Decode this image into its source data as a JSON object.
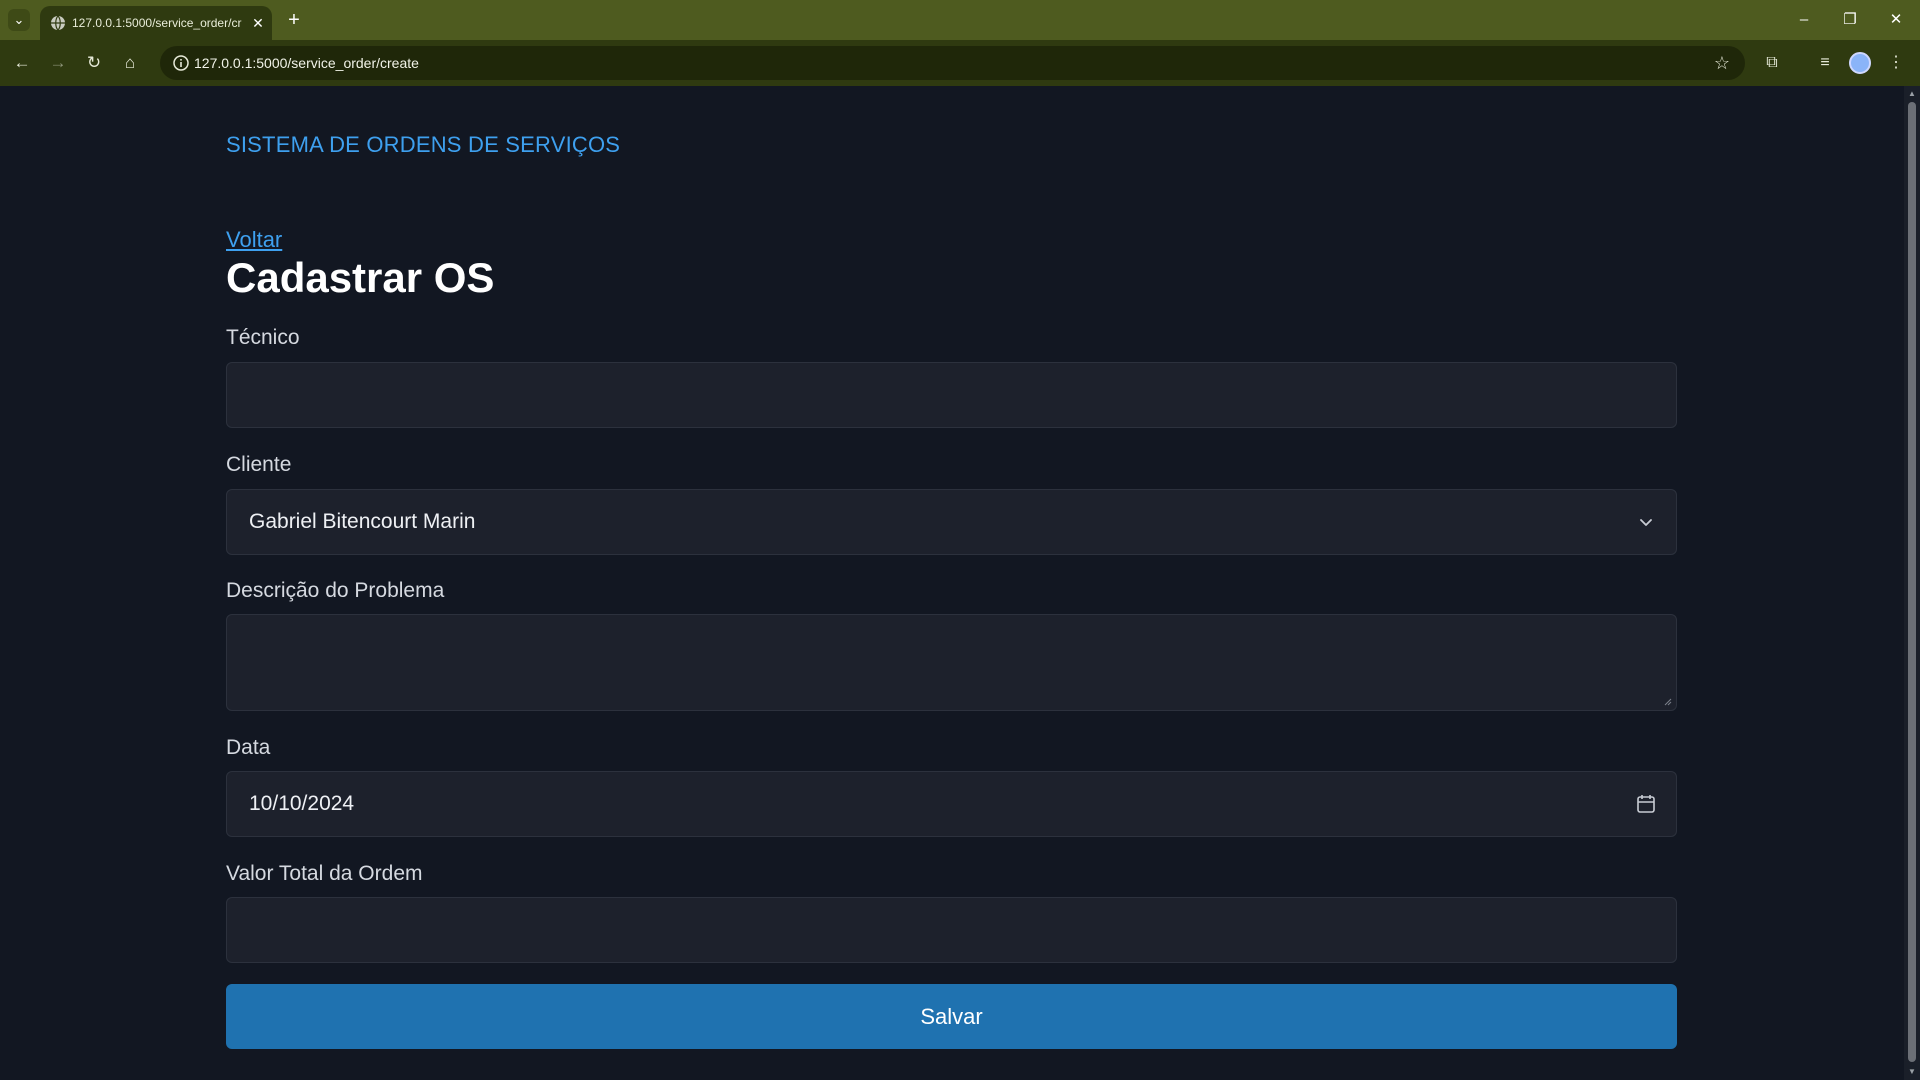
{
  "browser": {
    "tab_title": "127.0.0.1:5000/service_order/cr",
    "url": "127.0.0.1:5000/service_order/create",
    "window_controls": {
      "minimize": "–",
      "restore": "❐",
      "close": "✕"
    }
  },
  "page": {
    "brand": "SISTEMA DE ORDENS DE SERVIÇOS",
    "back_link": "Voltar",
    "title": "Cadastrar OS",
    "form": {
      "tecnico": {
        "label": "Técnico",
        "value": ""
      },
      "cliente": {
        "label": "Cliente",
        "value": "Gabriel Bitencourt Marin"
      },
      "descricao": {
        "label": "Descrição do Problema",
        "value": ""
      },
      "data": {
        "label": "Data",
        "value": "10/10/2024"
      },
      "valor_total": {
        "label": "Valor Total da Ordem",
        "value": ""
      }
    },
    "submit_label": "Salvar"
  },
  "colors": {
    "tabbar": "#4e5b1f",
    "toolbar": "#2f3a10",
    "page_bg": "#121722",
    "field_bg": "#1d212c",
    "link": "#3ea0ef",
    "button": "#1f72b0"
  },
  "icons": [
    "tab-list-icon",
    "globe-icon",
    "close-icon",
    "plus-icon",
    "back-icon",
    "forward-icon",
    "reload-icon",
    "home-icon",
    "info-icon",
    "star-icon",
    "extensions-icon",
    "media-icon",
    "profile-icon",
    "menu-icon",
    "chevron-down-icon",
    "calendar-icon"
  ]
}
